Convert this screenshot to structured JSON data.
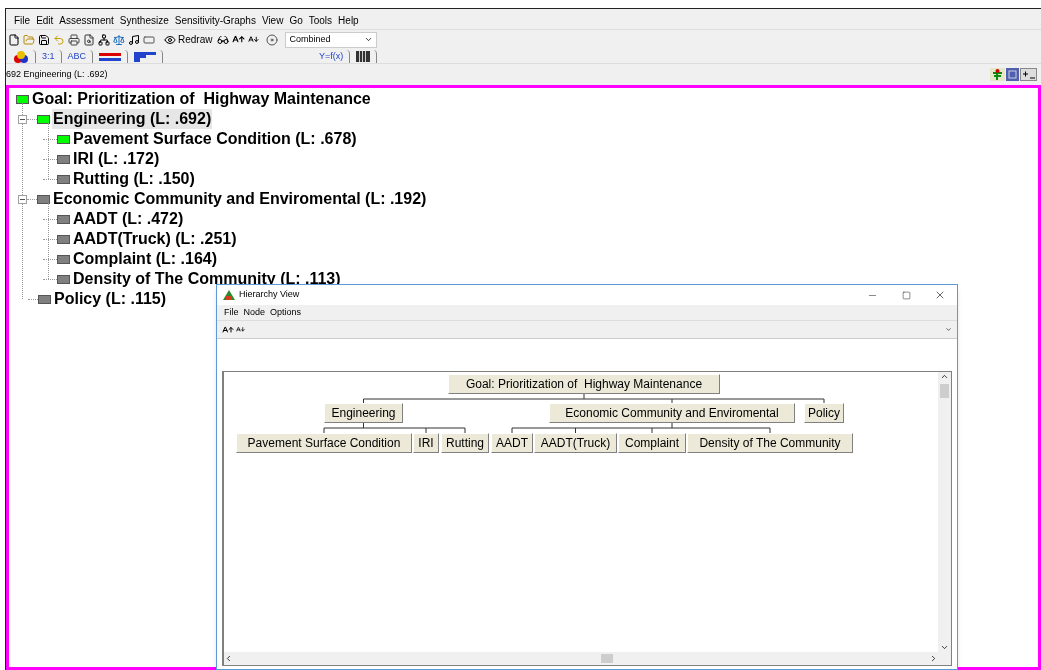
{
  "menu": [
    "File",
    "Edit",
    "Assessment",
    "Synthesize",
    "Sensitivity-Graphs",
    "View",
    "Go",
    "Tools",
    "Help"
  ],
  "toolbar": {
    "redraw": "Redraw",
    "mode": "Combined"
  },
  "view_tabs": [
    {
      "kind": "icon"
    },
    {
      "kind": "text",
      "label": "3:1"
    },
    {
      "kind": "text",
      "label": "ABC"
    },
    {
      "kind": "icon"
    },
    {
      "kind": "icon"
    },
    {
      "kind": "text",
      "label": "Y=f(x)"
    },
    {
      "kind": "icon"
    }
  ],
  "status": "692 Engineering (L: .692)",
  "tree": {
    "label": "Goal: Prioritization of  Highway Maintenance",
    "color": "#00ff00",
    "selected": false,
    "children": [
      {
        "label": "Engineering (L: .692)",
        "color": "#00ff00",
        "selected": true,
        "expanded": true,
        "children": [
          {
            "label": "Pavement Surface Condition (L: .678)",
            "color": "#00ff00",
            "selected": false
          },
          {
            "label": "IRI (L: .172)",
            "color": "#808080",
            "selected": false
          },
          {
            "label": "Rutting (L: .150)",
            "color": "#808080",
            "selected": false
          }
        ]
      },
      {
        "label": "Economic Community and Enviromental (L: .192)",
        "color": "#808080",
        "selected": false,
        "expanded": true,
        "children": [
          {
            "label": "AADT (L: .472)",
            "color": "#808080",
            "selected": false
          },
          {
            "label": "AADT(Truck) (L: .251)",
            "color": "#808080",
            "selected": false
          },
          {
            "label": "Complaint (L: .164)",
            "color": "#808080",
            "selected": false
          },
          {
            "label": "Density of The Community (L: .113)",
            "color": "#808080",
            "selected": false
          }
        ]
      },
      {
        "label": "Policy (L: .115)",
        "color": "#808080",
        "selected": false
      }
    ]
  },
  "hierarchy_window": {
    "title": "Hierarchy View",
    "menu": [
      "File",
      "Node",
      "Options"
    ],
    "diagram": {
      "label": "Goal: Prioritization of  Highway Maintenance",
      "children": [
        {
          "label": "Engineering",
          "children": [
            {
              "label": "Pavement Surface Condition"
            },
            {
              "label": "IRI"
            },
            {
              "label": "Rutting"
            }
          ]
        },
        {
          "label": "Economic Community and Enviromental",
          "children": [
            {
              "label": "AADT"
            },
            {
              "label": "AADT(Truck)"
            },
            {
              "label": "Complaint"
            },
            {
              "label": "Density of The Community"
            }
          ]
        },
        {
          "label": "Policy"
        }
      ]
    }
  }
}
